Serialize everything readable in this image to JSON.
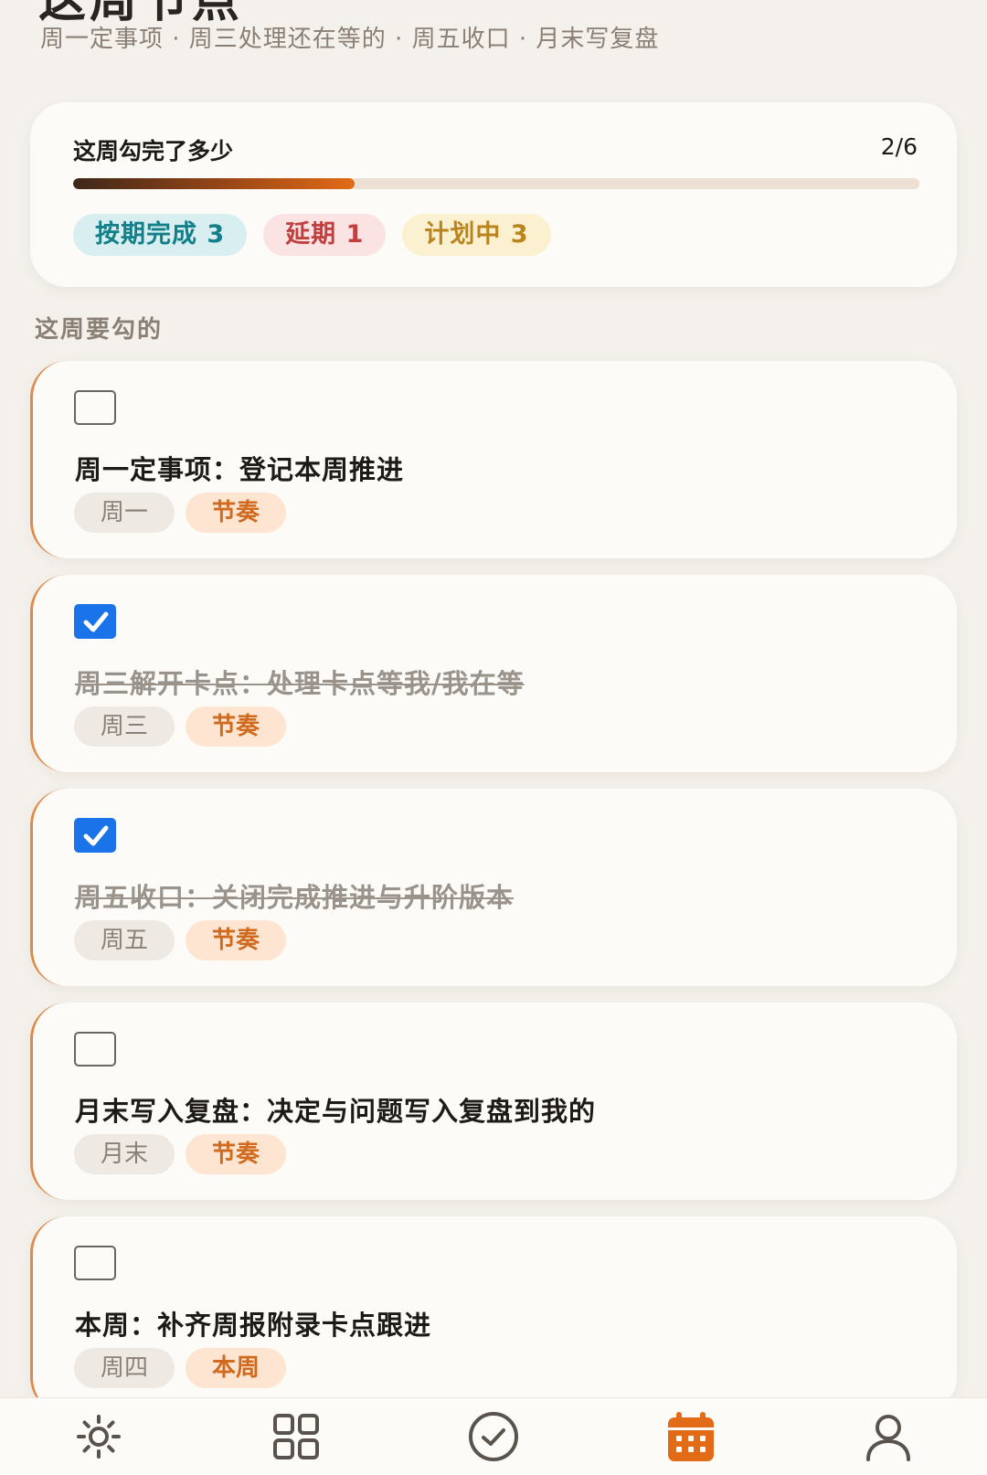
{
  "header": {
    "title_partial": "这周节点",
    "subtitle": "周一定事项 · 周三处理还在等的 · 周五收口 · 月末写复盘"
  },
  "progress": {
    "title": "这周勾完了多少",
    "count_label": "2/6",
    "fraction": 0.333,
    "stats": [
      {
        "label": "按期完成 3",
        "kind": "ontime"
      },
      {
        "label": "延期 1",
        "kind": "delayed"
      },
      {
        "label": "计划中 3",
        "kind": "planned"
      }
    ]
  },
  "section": {
    "label": "这周要勾的"
  },
  "tasks": [
    {
      "title": "周一定事项：登记本周推进",
      "checked": false,
      "day": "周一",
      "type": "节奏"
    },
    {
      "title": "周三解开卡点：处理卡点等我/我在等",
      "checked": true,
      "day": "周三",
      "type": "节奏"
    },
    {
      "title": "周五收口：关闭完成推进与升阶版本",
      "checked": true,
      "day": "周五",
      "type": "节奏"
    },
    {
      "title": "月末写入复盘：决定与问题写入复盘到我的",
      "checked": false,
      "day": "月末",
      "type": "节奏"
    },
    {
      "title": "本周：补齐周报附录卡点跟进",
      "checked": false,
      "day": "周四",
      "type": "本周"
    }
  ],
  "nav": {
    "items": [
      {
        "icon": "sun-icon",
        "active": false
      },
      {
        "icon": "grid-icon",
        "active": false
      },
      {
        "icon": "check-circle-icon",
        "active": false
      },
      {
        "icon": "calendar-icon",
        "active": true
      },
      {
        "icon": "user-icon",
        "active": false
      }
    ]
  },
  "colors": {
    "accent": "#e26b17",
    "check_blue": "#1a73e8",
    "nav_inactive": "#5a534d"
  }
}
